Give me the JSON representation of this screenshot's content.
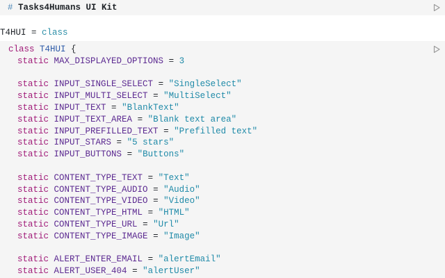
{
  "header": {
    "hash": "#",
    "title": "Tasks4Humans UI Kit"
  },
  "output": {
    "name": "T4HUI",
    "eq": " = ",
    "value": "class"
  },
  "code": {
    "class_keyword": "class",
    "class_name": "T4HUI",
    "open_brace": " {",
    "lines": [
      {
        "kw": "static",
        "name": "MAX_DISPLAYED_OPTIONS",
        "eq": " = ",
        "value": "3"
      },
      null,
      {
        "kw": "static",
        "name": "INPUT_SINGLE_SELECT",
        "eq": " = ",
        "value": "\"SingleSelect\""
      },
      {
        "kw": "static",
        "name": "INPUT_MULTI_SELECT",
        "eq": " = ",
        "value": "\"MultiSelect\""
      },
      {
        "kw": "static",
        "name": "INPUT_TEXT",
        "eq": " = ",
        "value": "\"BlankText\""
      },
      {
        "kw": "static",
        "name": "INPUT_TEXT_AREA",
        "eq": " = ",
        "value": "\"Blank text area\""
      },
      {
        "kw": "static",
        "name": "INPUT_PREFILLED_TEXT",
        "eq": " = ",
        "value": "\"Prefilled text\""
      },
      {
        "kw": "static",
        "name": "INPUT_STARS",
        "eq": " = ",
        "value": "\"5 stars\""
      },
      {
        "kw": "static",
        "name": "INPUT_BUTTONS",
        "eq": " = ",
        "value": "\"Buttons\""
      },
      null,
      {
        "kw": "static",
        "name": "CONTENT_TYPE_TEXT",
        "eq": " = ",
        "value": "\"Text\""
      },
      {
        "kw": "static",
        "name": "CONTENT_TYPE_AUDIO",
        "eq": " = ",
        "value": "\"Audio\""
      },
      {
        "kw": "static",
        "name": "CONTENT_TYPE_VIDEO",
        "eq": " = ",
        "value": "\"Video\""
      },
      {
        "kw": "static",
        "name": "CONTENT_TYPE_HTML",
        "eq": " = ",
        "value": "\"HTML\""
      },
      {
        "kw": "static",
        "name": "CONTENT_TYPE_URL",
        "eq": " = ",
        "value": "\"Url\""
      },
      {
        "kw": "static",
        "name": "CONTENT_TYPE_IMAGE",
        "eq": " = ",
        "value": "\"Image\""
      },
      null,
      {
        "kw": "static",
        "name": "ALERT_ENTER_EMAIL",
        "eq": " = ",
        "value": "\"alertEmail\""
      },
      {
        "kw": "static",
        "name": "ALERT_USER_404",
        "eq": " = ",
        "value": "\"alertUser\""
      }
    ]
  },
  "icons": {
    "run_header": "play-icon",
    "run_code": "play-icon"
  },
  "colors": {
    "keyword": "#a01a78",
    "identifier": "#5c2a91",
    "string": "#1f8aa8",
    "cell_background": "#f5f5f5"
  }
}
